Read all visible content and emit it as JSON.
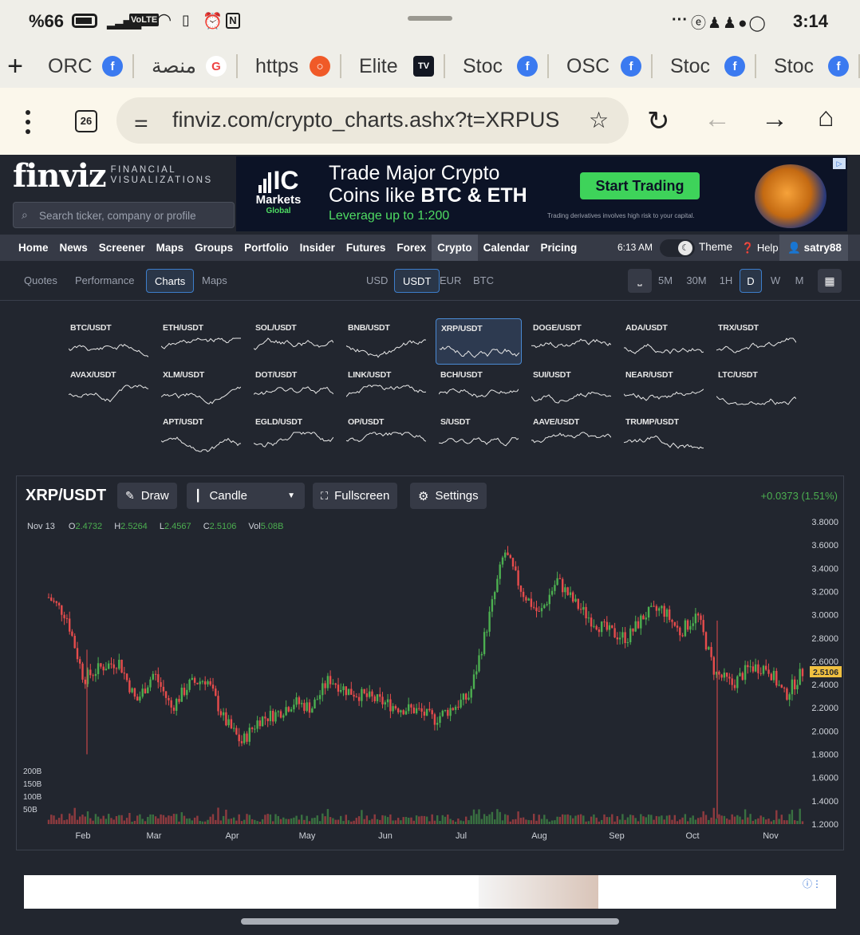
{
  "status_bar": {
    "battery": "%66",
    "clock": "3:14",
    "network_badge": "VoLTE",
    "dots": "···"
  },
  "tabs": [
    {
      "label": "ORC",
      "icon": "facebook-icon",
      "color": "#3b7af0"
    },
    {
      "label": "منصة",
      "icon": "google-icon",
      "color": "#ffffff"
    },
    {
      "label": "https",
      "icon": "circle-icon",
      "color": "#f05a28"
    },
    {
      "label": "Elite",
      "icon": "tradingview-icon",
      "color": "#131722"
    },
    {
      "label": "Stoc",
      "icon": "facebook-icon",
      "color": "#3b7af0"
    },
    {
      "label": "OSC",
      "icon": "facebook-icon",
      "color": "#3b7af0"
    },
    {
      "label": "Stoc",
      "icon": "facebook-icon",
      "color": "#3b7af0"
    },
    {
      "label": "Stoc",
      "icon": "facebook-icon",
      "color": "#3b7af0"
    }
  ],
  "browser": {
    "tab_count": "26",
    "url": "finviz.com/crypto_charts.ashx?t=XRPUS"
  },
  "finviz": {
    "logo": "finviz",
    "tagline_1": "FINANCIAL",
    "tagline_2": "VISUALIZATIONS",
    "search_placeholder": "Search ticker, company or profile"
  },
  "ad": {
    "brand_1": "IC",
    "brand_2": "Markets",
    "brand_3": "Global",
    "headline_1": "Trade Major Crypto",
    "headline_2a": "Coins like ",
    "headline_2b": "BTC & ETH",
    "sub": "Leverage up to 1:200",
    "cta": "Start Trading",
    "disclaimer": "Trading derivatives involves high risk to your capital."
  },
  "nav": {
    "items": [
      "Home",
      "News",
      "Screener",
      "Maps",
      "Groups",
      "Portfolio",
      "Insider",
      "Futures",
      "Forex",
      "Crypto",
      "Calendar",
      "Pricing"
    ],
    "active": "Crypto",
    "time": "6:13 AM",
    "theme": "Theme",
    "help": "Help",
    "user": "satry88"
  },
  "subnav": {
    "views": [
      "Quotes",
      "Performance",
      "Charts",
      "Maps"
    ],
    "active_view": "Charts",
    "quotes": [
      "USD",
      "USDT",
      "EUR",
      "BTC"
    ],
    "active_quote": "USDT",
    "timeframes": [
      "5M",
      "30M",
      "1H",
      "D",
      "W",
      "M"
    ],
    "active_tf": "D"
  },
  "mini_charts": [
    "BTC/USDT",
    "ETH/USDT",
    "SOL/USDT",
    "BNB/USDT",
    "XRP/USDT",
    "DOGE/USDT",
    "ADA/USDT",
    "TRX/USDT",
    "AVAX/USDT",
    "XLM/USDT",
    "DOT/USDT",
    "LINK/USDT",
    "BCH/USDT",
    "SUI/USDT",
    "NEAR/USDT",
    "LTC/USDT",
    "APT/USDT",
    "EGLD/USDT",
    "OP/USDT",
    "S/USDT",
    "AAVE/USDT",
    "TRUMP/USDT"
  ],
  "mini_selected": "XRP/USDT",
  "chart": {
    "symbol": "XRP/USDT",
    "draw": "Draw",
    "type": "Candle",
    "fullscreen": "Fullscreen",
    "settings": "Settings",
    "change": "+0.0373 (1.51%)",
    "ohlc": {
      "date": "Nov 13",
      "O": "2.4732",
      "H": "2.5264",
      "L": "2.4567",
      "C": "2.5106",
      "Vol": "5.08B"
    },
    "last_price": "2.5106",
    "up_color": "#4caf50",
    "down_color": "#e74c4c"
  },
  "chart_data": {
    "type": "candlestick",
    "title": "XRP/USDT",
    "ylim": [
      1.2,
      3.8
    ],
    "y_ticks": [
      "3.8000",
      "3.6000",
      "3.4000",
      "3.2000",
      "3.0000",
      "2.8000",
      "2.6000",
      "2.4000",
      "2.2000",
      "2.0000",
      "1.8000",
      "1.6000",
      "1.4000",
      "1.2000"
    ],
    "x_ticks": [
      "Feb",
      "Mar",
      "Apr",
      "May",
      "Jun",
      "Jul",
      "Aug",
      "Sep",
      "Oct",
      "Nov"
    ],
    "volume_ticks": [
      "200B",
      "150B",
      "100B",
      "50B"
    ],
    "close_path": [
      {
        "date": "Jan 20",
        "close": 3.15
      },
      {
        "date": "Jan 27",
        "close": 3.0
      },
      {
        "date": "Feb 03",
        "close": 2.45
      },
      {
        "date": "Feb 10",
        "close": 2.55
      },
      {
        "date": "Feb 17",
        "close": 2.6
      },
      {
        "date": "Feb 24",
        "close": 2.25
      },
      {
        "date": "Mar 03",
        "close": 2.5
      },
      {
        "date": "Mar 10",
        "close": 2.2
      },
      {
        "date": "Mar 17",
        "close": 2.4
      },
      {
        "date": "Mar 24",
        "close": 2.45
      },
      {
        "date": "Mar 31",
        "close": 2.1
      },
      {
        "date": "Apr 07",
        "close": 1.9
      },
      {
        "date": "Apr 14",
        "close": 2.1
      },
      {
        "date": "Apr 21",
        "close": 2.15
      },
      {
        "date": "Apr 28",
        "close": 2.25
      },
      {
        "date": "May 05",
        "close": 2.2
      },
      {
        "date": "May 12",
        "close": 2.45
      },
      {
        "date": "May 19",
        "close": 2.35
      },
      {
        "date": "May 26",
        "close": 2.3
      },
      {
        "date": "Jun 02",
        "close": 2.25
      },
      {
        "date": "Jun 09",
        "close": 2.2
      },
      {
        "date": "Jun 16",
        "close": 2.18
      },
      {
        "date": "Jun 23",
        "close": 2.1
      },
      {
        "date": "Jun 30",
        "close": 2.2
      },
      {
        "date": "Jul 07",
        "close": 2.3
      },
      {
        "date": "Jul 14",
        "close": 2.9
      },
      {
        "date": "Jul 18",
        "close": 3.55
      },
      {
        "date": "Jul 25",
        "close": 3.2
      },
      {
        "date": "Aug 01",
        "close": 3.0
      },
      {
        "date": "Aug 08",
        "close": 3.3
      },
      {
        "date": "Aug 15",
        "close": 3.1
      },
      {
        "date": "Aug 22",
        "close": 2.95
      },
      {
        "date": "Aug 29",
        "close": 2.85
      },
      {
        "date": "Sep 05",
        "close": 2.8
      },
      {
        "date": "Sep 12",
        "close": 3.0
      },
      {
        "date": "Sep 19",
        "close": 3.05
      },
      {
        "date": "Sep 26",
        "close": 2.85
      },
      {
        "date": "Oct 03",
        "close": 3.0
      },
      {
        "date": "Oct 10",
        "close": 2.5
      },
      {
        "date": "Oct 17",
        "close": 2.4
      },
      {
        "date": "Oct 24",
        "close": 2.55
      },
      {
        "date": "Oct 31",
        "close": 2.55
      },
      {
        "date": "Nov 07",
        "close": 2.3
      },
      {
        "date": "Nov 13",
        "close": 2.51
      }
    ]
  }
}
